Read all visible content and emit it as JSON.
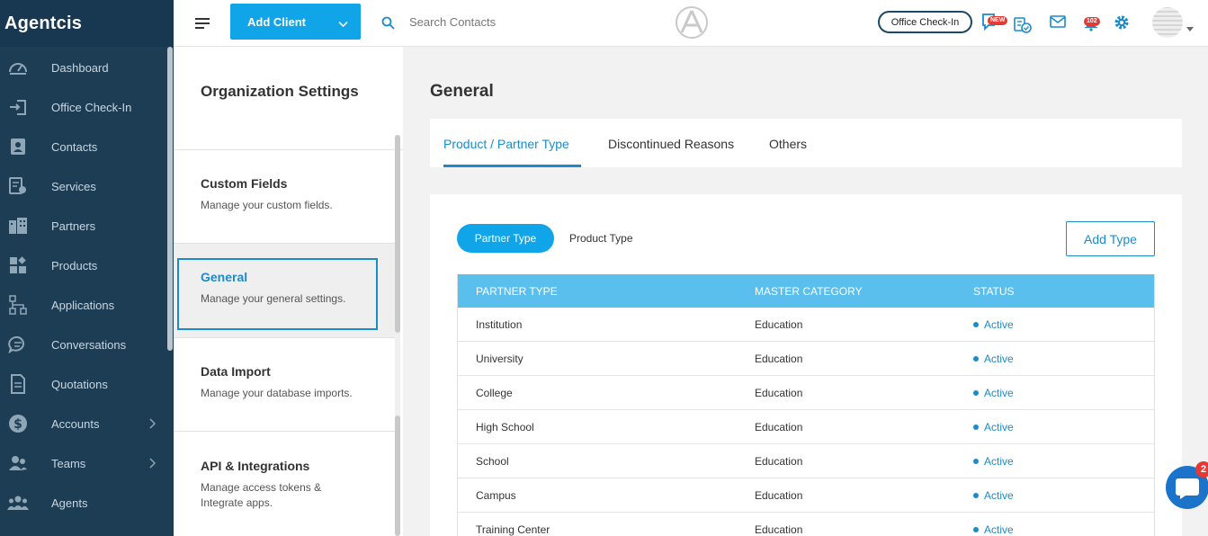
{
  "app": {
    "brand": "Agentcis"
  },
  "sidebar": {
    "items": [
      {
        "label": "Dashboard",
        "icon": "dashboard-icon"
      },
      {
        "label": "Office Check-In",
        "icon": "check-in-icon"
      },
      {
        "label": "Contacts",
        "icon": "contacts-icon"
      },
      {
        "label": "Services",
        "icon": "services-icon"
      },
      {
        "label": "Partners",
        "icon": "partners-icon"
      },
      {
        "label": "Products",
        "icon": "products-icon"
      },
      {
        "label": "Applications",
        "icon": "applications-icon"
      },
      {
        "label": "Conversations",
        "icon": "conversations-icon"
      },
      {
        "label": "Quotations",
        "icon": "quotations-icon"
      },
      {
        "label": "Accounts",
        "icon": "accounts-icon",
        "has_submenu": true
      },
      {
        "label": "Teams",
        "icon": "teams-icon",
        "has_submenu": true
      },
      {
        "label": "Agents",
        "icon": "agents-icon"
      }
    ]
  },
  "header": {
    "add_client_label": "Add Client",
    "search_placeholder": "Search Contacts",
    "office_checkin_label": "Office Check-In",
    "new_badge": "NEW",
    "notification_count": "102"
  },
  "settings_panel": {
    "title": "Organization Settings",
    "items": [
      {
        "title": "Custom Fields",
        "desc": "Manage your custom fields."
      },
      {
        "title": "General",
        "desc": "Manage your general settings.",
        "active": true
      },
      {
        "title": "Data Import",
        "desc": "Manage your database imports."
      },
      {
        "title": "API & Integrations",
        "desc": "Manage access tokens & Integrate apps."
      }
    ]
  },
  "main": {
    "title": "General",
    "tabs": [
      {
        "label": "Product / Partner Type",
        "active": true
      },
      {
        "label": "Discontinued Reasons"
      },
      {
        "label": "Others"
      }
    ],
    "type_toggle": {
      "active": "Partner Type",
      "other": "Product Type"
    },
    "add_type_label": "Add Type",
    "table": {
      "columns": [
        "PARTNER TYPE",
        "MASTER CATEGORY",
        "STATUS"
      ],
      "rows": [
        {
          "type": "Institution",
          "category": "Education",
          "status": "Active"
        },
        {
          "type": "University",
          "category": "Education",
          "status": "Active"
        },
        {
          "type": "College",
          "category": "Education",
          "status": "Active"
        },
        {
          "type": "High School",
          "category": "Education",
          "status": "Active"
        },
        {
          "type": "School",
          "category": "Education",
          "status": "Active"
        },
        {
          "type": "Campus",
          "category": "Education",
          "status": "Active"
        },
        {
          "type": "Training Center",
          "category": "Education",
          "status": "Active"
        }
      ]
    }
  },
  "chat_widget": {
    "count": "2"
  },
  "colors": {
    "sidebar_bg": "#1d3d54",
    "accent": "#10a5e8",
    "link": "#1a8ccc",
    "table_header": "#5bbfee"
  }
}
